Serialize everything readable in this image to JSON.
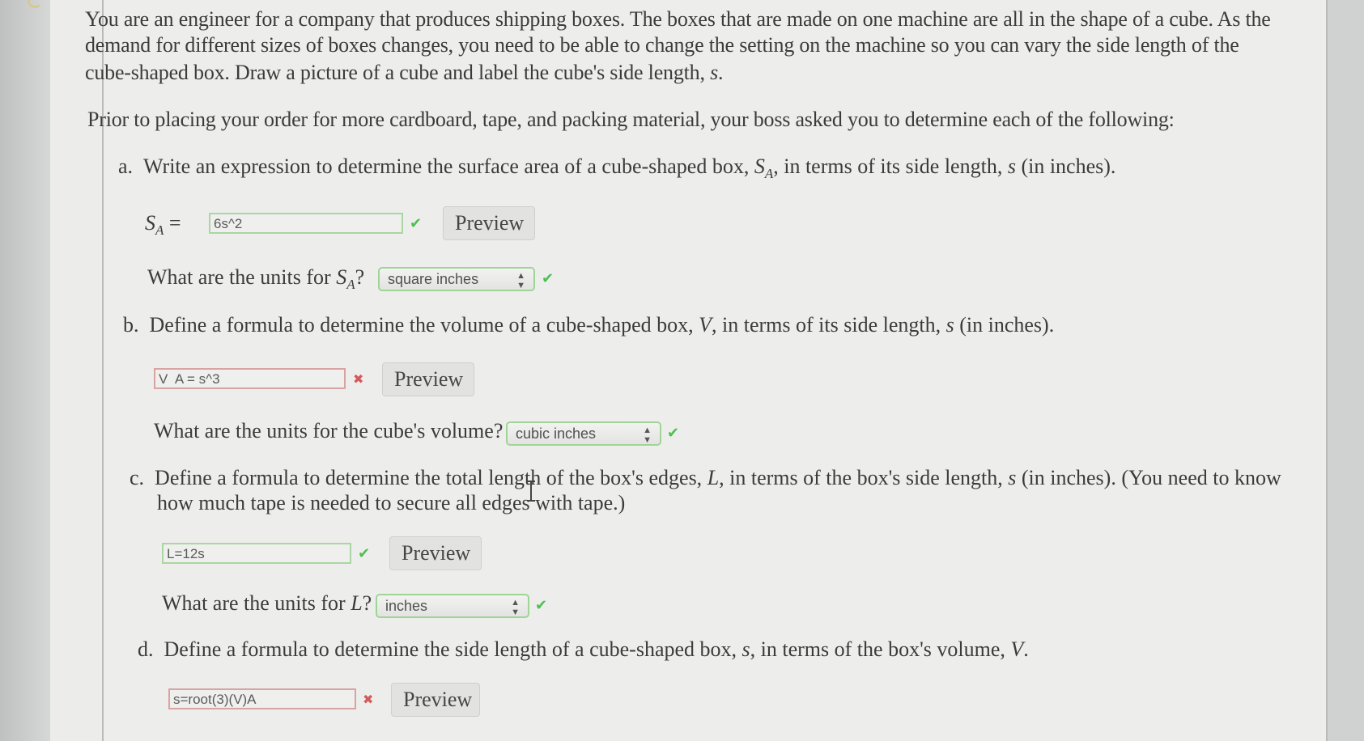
{
  "intro": {
    "line1": "You are an engineer for a company that produces shipping boxes. The boxes that are made on one machine are all in the shape of a cube. As the",
    "line2": "demand for different sizes of boxes changes, you need to be able to change the setting on the machine so you can vary the side length of the",
    "line3_pre": "cube-shaped box. Draw a picture of a cube and label the cube's side length, ",
    "line3_var": "s",
    "line3_post": "."
  },
  "prompt": "Prior to placing your order for more cardboard, tape, and packing material, your boss asked you to determine each of the following:",
  "parts": {
    "a": {
      "marker": "a.",
      "text_pre": "Write an expression to determine the surface area of a cube-shaped box, ",
      "var": "S",
      "var_sub": "A",
      "text_mid": ", in terms of its side length, ",
      "var2": "s",
      "text_post": " (in inches).",
      "label_var": "S",
      "label_sub": "A",
      "label_eq": " =",
      "answer": "6s^2",
      "answer_status": "correct",
      "preview_label": "Preview",
      "units_q_pre": "What are the units for ",
      "units_q_var": "S",
      "units_q_sub": "A",
      "units_q_post": "?",
      "units_value": "square inches",
      "units_status": "correct"
    },
    "b": {
      "marker": "b.",
      "text_pre": "Define a formula to determine the volume of a cube-shaped box, ",
      "var": "V",
      "text_mid": ", in terms of its side length, ",
      "var2": "s",
      "text_post": " (in inches).",
      "answer": "V  A = s^3",
      "answer_status": "incorrect",
      "preview_label": "Preview",
      "units_q": "What are the units for the cube's volume?",
      "units_value": "cubic inches",
      "units_status": "correct"
    },
    "c": {
      "marker": "c.",
      "line1_pre": "Define a formula to determine the total length of the box's edges, ",
      "var": "L",
      "line1_mid": ", in terms of the box's side length, ",
      "var2": "s",
      "line1_post": " (in inches). (You need to know",
      "line2": "how much tape is needed to secure all edges with tape.)",
      "answer": "L=12s",
      "answer_status": "correct",
      "preview_label": "Preview",
      "units_q_pre": "What are the units for ",
      "units_q_var": "L",
      "units_q_post": "?",
      "units_value": "inches",
      "units_status": "correct"
    },
    "d": {
      "marker": "d.",
      "text_pre": "Define a formula to determine the side length of a cube-shaped box, ",
      "var": "s",
      "text_mid": ", in terms of the box's volume, ",
      "var2": "V",
      "text_post": ".",
      "answer": "s=root(3)(V)A",
      "answer_status": "incorrect",
      "preview_label": "Preview"
    }
  },
  "icons": {
    "check": "✔",
    "cross": "✖",
    "select_arrows": "▲▼"
  }
}
